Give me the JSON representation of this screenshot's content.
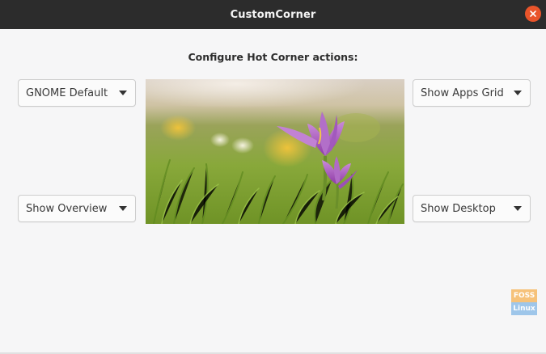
{
  "window": {
    "title": "CustomCorner"
  },
  "main": {
    "heading": "Configure Hot Corner actions:",
    "dropdowns": {
      "top_left": "GNOME Default",
      "top_right": "Show Apps Grid",
      "bottom_left": "Show Overview",
      "bottom_right": "Show Desktop"
    },
    "preview_icon": "crocus-flower-wallpaper"
  },
  "watermark": {
    "top": "FOSS",
    "bottom": "Linux"
  },
  "colors": {
    "titlebar": "#2c2c2c",
    "close_button": "#e9542a",
    "background": "#f6f6f7"
  }
}
